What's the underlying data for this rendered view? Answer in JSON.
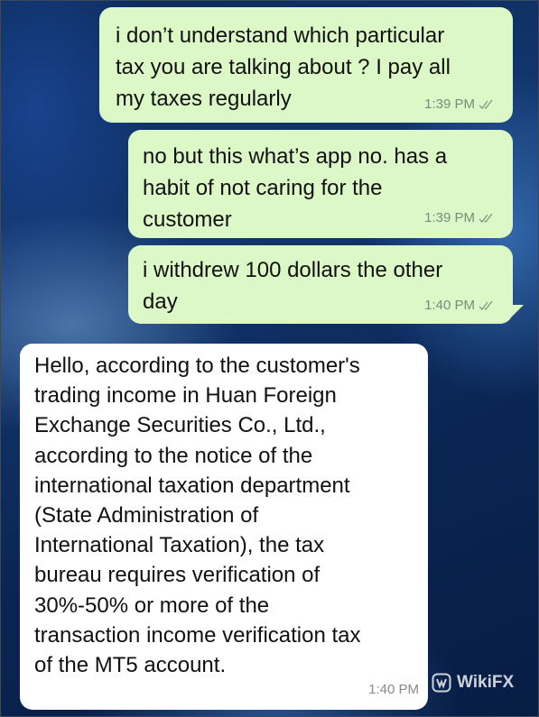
{
  "messages": [
    {
      "direction": "outgoing",
      "text": "i don’t understand which particular\ntax you are talking about ? I pay all\nmy taxes regularly",
      "time": "1:39 PM",
      "status_icon": "double-check-icon"
    },
    {
      "direction": "outgoing",
      "text": "no but this what’s app no. has a\nhabit of not caring for the\ncustomer",
      "time": "1:39 PM",
      "status_icon": "double-check-icon"
    },
    {
      "direction": "outgoing",
      "text": "i withdrew 100 dollars the other\nday",
      "time": "1:40 PM",
      "status_icon": "double-check-icon"
    },
    {
      "direction": "incoming",
      "text": "Hello, according to the customer's\ntrading income in Huan Foreign\nExchange Securities Co., Ltd.,\naccording to the notice of the\ninternational taxation department\n(State Administration of\nInternational Taxation), the tax\nbureau requires verification of\n30%-50% or more of the\ntransaction income verification tax\nof the MT5 account.",
      "time": "1:40 PM"
    }
  ],
  "watermark": {
    "label": "WikiFX",
    "icon": "wikifx-logo-icon"
  },
  "colors": {
    "outgoing_bubble": "#dcf8c6",
    "incoming_bubble": "#ffffff",
    "timestamp": "#7a8a7a"
  }
}
